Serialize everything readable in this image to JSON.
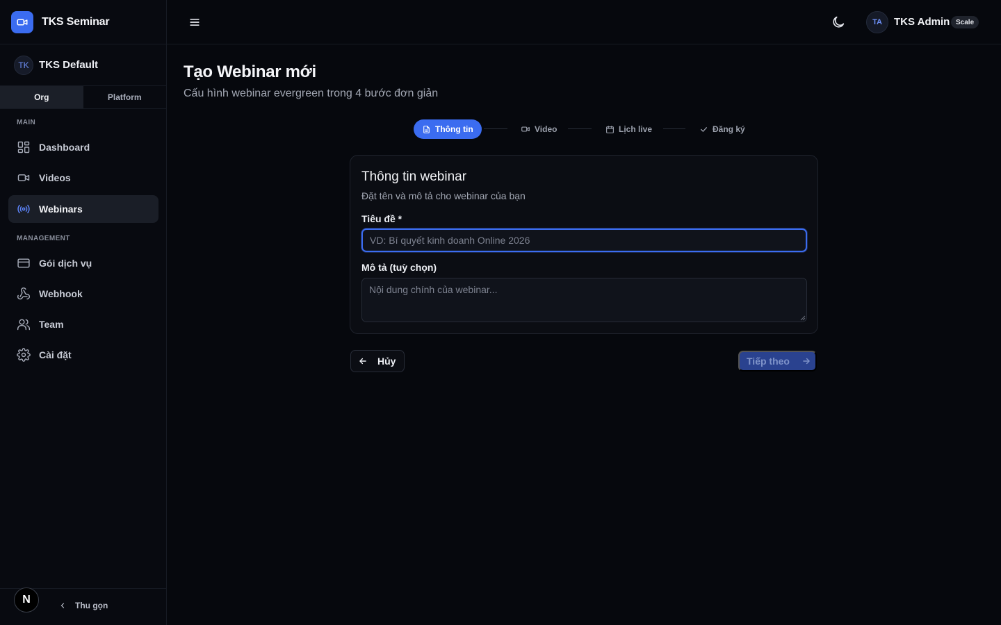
{
  "brand": {
    "name": "TKS Seminar",
    "logo_icon": "video-camera-icon",
    "accent": "#3b6cf0"
  },
  "org": {
    "avatar": "TK",
    "name": "TKS Default"
  },
  "scope_tabs": [
    {
      "label": "Org",
      "active": true
    },
    {
      "label": "Platform",
      "active": false
    }
  ],
  "sidebar": {
    "main_section": "MAIN",
    "main_items": [
      {
        "label": "Dashboard",
        "icon": "dashboard-grid-icon"
      },
      {
        "label": "Videos",
        "icon": "video-icon"
      },
      {
        "label": "Webinars",
        "icon": "broadcast-icon",
        "active": true
      }
    ],
    "management_section": "MANAGEMENT",
    "management_items": [
      {
        "label": "Gói dịch vụ",
        "icon": "credit-card-icon"
      },
      {
        "label": "Webhook",
        "icon": "webhook-icon"
      },
      {
        "label": "Team",
        "icon": "users-icon"
      },
      {
        "label": "Cài đặt",
        "icon": "gear-icon"
      }
    ],
    "bottom_badge": "N",
    "collapse_label": "Thu gọn"
  },
  "header": {
    "user_avatar": "TA",
    "user_name": "TKS Admin",
    "plan_badge": "Scale"
  },
  "page": {
    "title": "Tạo Webinar mới",
    "subtitle": "Cấu hình webinar evergreen trong 4 bước đơn giản"
  },
  "steps": [
    {
      "label": "Thông tin",
      "icon": "document-icon",
      "active": true
    },
    {
      "label": "Video",
      "icon": "video-icon",
      "active": false
    },
    {
      "label": "Lịch live",
      "icon": "calendar-icon",
      "active": false
    },
    {
      "label": "Đăng ký",
      "icon": "check-icon",
      "active": false
    }
  ],
  "form": {
    "card_title": "Thông tin webinar",
    "card_subtitle": "Đặt tên và mô tả cho webinar của bạn",
    "title_label": "Tiêu đề *",
    "title_value": "",
    "title_placeholder": "VD: Bí quyết kinh doanh Online 2026",
    "desc_label": "Mô tả (tuỳ chọn)",
    "desc_value": "",
    "desc_placeholder": "Nội dung chính của webinar..."
  },
  "actions": {
    "cancel_label": "Hủy",
    "next_label": "Tiếp theo",
    "next_disabled": true
  }
}
